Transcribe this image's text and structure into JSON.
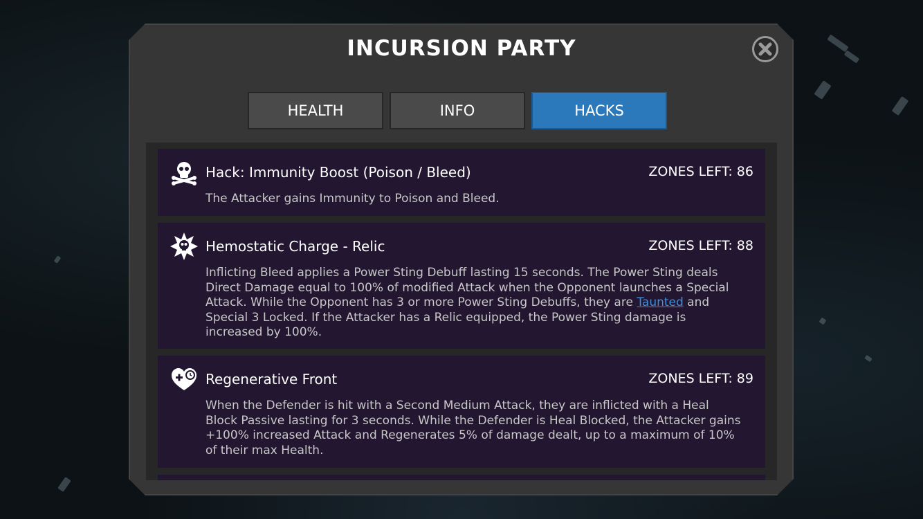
{
  "dialog": {
    "title": "INCURSION PARTY",
    "close_icon": "close-x-icon"
  },
  "tabs": [
    {
      "label": "HEALTH",
      "active": false
    },
    {
      "label": "INFO",
      "active": false
    },
    {
      "label": "HACKS",
      "active": true
    }
  ],
  "hacks": [
    {
      "icon": "skull-crossbones-icon",
      "title": "Hack: Immunity Boost (Poison / Bleed)",
      "zones_left": "ZONES LEFT: 86",
      "description": "The Attacker gains Immunity to Poison and Bleed."
    },
    {
      "icon": "skull-burst-icon",
      "title": "Hemostatic Charge - Relic",
      "zones_left": "ZONES LEFT: 88",
      "description_before_link": "Inflicting Bleed applies a Power Sting Debuff lasting 15 seconds. The Power Sting deals Direct Damage equal to 100% of modified Attack when the Opponent launches a Special Attack. While the Opponent has 3 or more Power Sting Debuffs, they are ",
      "description_link": "Taunted",
      "description_after_link": " and Special 3 Locked. If the Attacker has a Relic equipped, the Power Sting damage is increased by 100%."
    },
    {
      "icon": "heal-block-icon",
      "title": "Regenerative Front",
      "zones_left": "ZONES LEFT: 89",
      "description": "When the Defender is hit with a Second Medium Attack, they are inflicted with a Heal Block Passive lasting for 3 seconds. While the Defender is Heal Blocked, the Attacker gains +100% increased Attack and Regenerates 5% of damage dealt, up to a maximum of 10% of their max Health."
    }
  ],
  "colors": {
    "active_tab": "#2b79ba",
    "card_bg": "#221631",
    "link": "#3f8fe0"
  }
}
